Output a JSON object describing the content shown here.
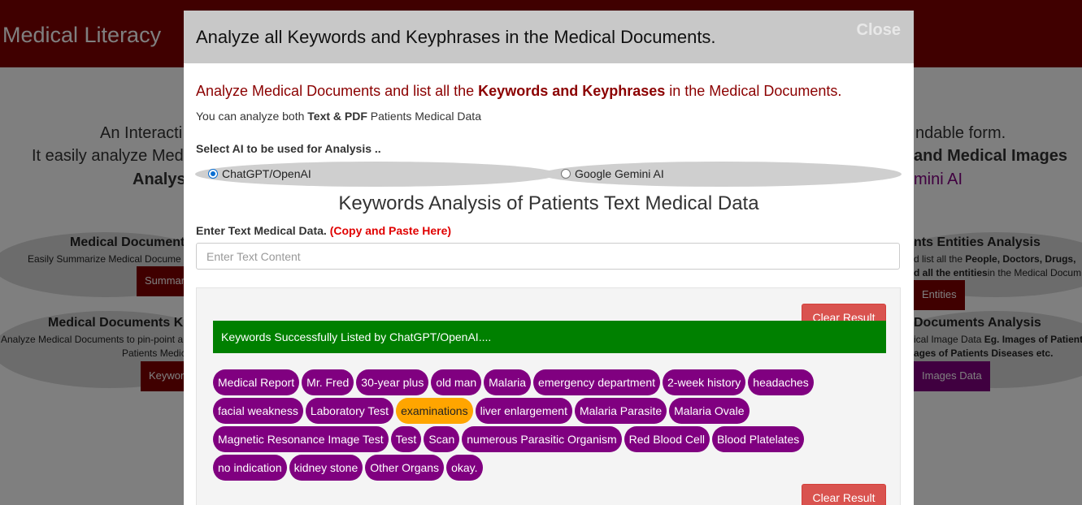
{
  "background": {
    "brand": "Medical Literacy",
    "intro_lines": [
      {
        "left": "An Interacti",
        "right": "ndable form."
      },
      {
        "left": "It easily analyze Med",
        "right": "and Medical Images"
      },
      {
        "left": "Analys",
        "right": "mini AI"
      }
    ],
    "cards": [
      {
        "title": "Medical Document",
        "desc": "Easily Summarize Medical Docume",
        "button": "Summar"
      },
      {
        "title": "nts Entities Analysis",
        "desc_a": "d list all the ",
        "desc_b": "People, Doctors, Drugs,",
        "desc_c": "d all the entities",
        "desc_d": "in the Medical Docum",
        "button": "Entities"
      },
      {
        "title": "Medical Documents K",
        "desc": "Analyze Medical Documents to pin-point a",
        "desc2": "Patients Medic",
        "button": "Keywor"
      },
      {
        "title": "Documents Analysis",
        "desc_a": "ical Image Data ",
        "desc_b": "Eg. Images of Patient",
        "desc_c": "ages of Patients Diseases etc.",
        "button": "Images Data"
      }
    ]
  },
  "modal": {
    "title": "Analyze all Keywords and Keyphrases in the Medical Documents.",
    "close_label": "Close",
    "intro_a": "Analyze Medical Documents and list all the ",
    "intro_b": "Keywords and Keyphrases",
    "intro_c": " in the Medical Documents.",
    "sub_a": "You can analyze both ",
    "sub_b": "Text & PDF",
    "sub_c": " Patients Medical Data",
    "select_label": "Select AI to be used for Analysis ..",
    "ai_options": [
      {
        "label": "ChatGPT/OpenAI",
        "checked": true
      },
      {
        "label": "Google Gemini AI",
        "checked": false
      }
    ],
    "section_title": "Keywords Analysis of Patients Text Medical Data",
    "enter_label": "Enter Text Medical Data.",
    "enter_hint": "(Copy and Paste Here)",
    "input_placeholder": "Enter Text Content",
    "clear_label": "Clear Result",
    "success_message": "Keywords Successfully Listed by ChatGPT/OpenAI....",
    "keyword_rows": [
      [
        "Medical Report",
        "Mr. Fred",
        "30-year plus",
        "old man",
        "Malaria",
        "emergency department",
        "2-week history",
        "headaches"
      ],
      [
        "facial weakness",
        "Laboratory Test",
        "examinations",
        "liver enlargement",
        "Malaria Parasite",
        "Malaria Ovale"
      ],
      [
        "Magnetic Resonance Image Test",
        "Test",
        "Scan",
        "numerous Parasitic Organism",
        "Red Blood Cell",
        "Blood Platelates"
      ],
      [
        "no indication",
        "kidney stone",
        "Other Organs",
        "okay."
      ]
    ],
    "highlighted_keyword": "examinations"
  },
  "colors": {
    "brand": "#800000",
    "keyword": "#800080",
    "keyword_highlight": "#ffa500",
    "success": "#008000",
    "danger": "#d9534f",
    "intro_text": "#8b0000"
  }
}
